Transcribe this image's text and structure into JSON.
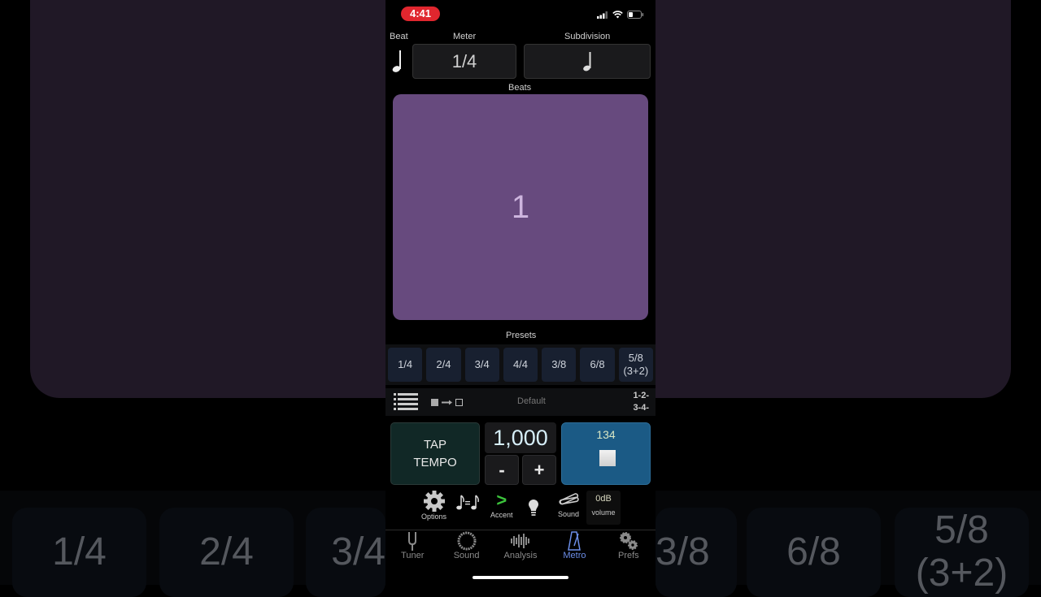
{
  "background": {
    "presets": [
      "1/4",
      "2/4",
      "3/4",
      "3/8",
      "6/8",
      "5/8\n(3+2)"
    ]
  },
  "status_bar": {
    "time": "4:41"
  },
  "header": {
    "beat_label": "Beat",
    "meter_label": "Meter",
    "meter_value": "1/4",
    "subdivision_label": "Subdivision",
    "beat_note_icon": "quarter-note",
    "subdivision_note_icon": "quarter-note"
  },
  "beats": {
    "label": "Beats",
    "current_beat": "1",
    "color": "#674a7e"
  },
  "presets": {
    "label": "Presets",
    "items": [
      "1/4",
      "2/4",
      "3/4",
      "4/4",
      "3/8",
      "6/8",
      "5/8\n(3+2)"
    ]
  },
  "tools": {
    "preset_name": "Default",
    "count_label_line1": "1-2-",
    "count_label_line2": "3-4-"
  },
  "controls": {
    "tap_line1": "TAP",
    "tap_line2": "TEMPO",
    "tempo_value": "1,000",
    "minus_label": "-",
    "plus_label": "+",
    "play_count": "134",
    "play_color": "#1b5a85"
  },
  "icon_row": {
    "options_label": "Options",
    "accent_label": "Accent",
    "accent_glyph": ">",
    "sound_label": "Sound",
    "volume_value": "0dB",
    "volume_label": "volume"
  },
  "tab_bar": {
    "items": [
      {
        "label": "Tuner",
        "icon": "tuning-fork"
      },
      {
        "label": "Sound",
        "icon": "ring"
      },
      {
        "label": "Analysis",
        "icon": "waveform"
      },
      {
        "label": "Metro",
        "icon": "metronome",
        "active": true
      },
      {
        "label": "Prefs",
        "icon": "gears"
      }
    ],
    "active_color": "#6c8ee8"
  }
}
